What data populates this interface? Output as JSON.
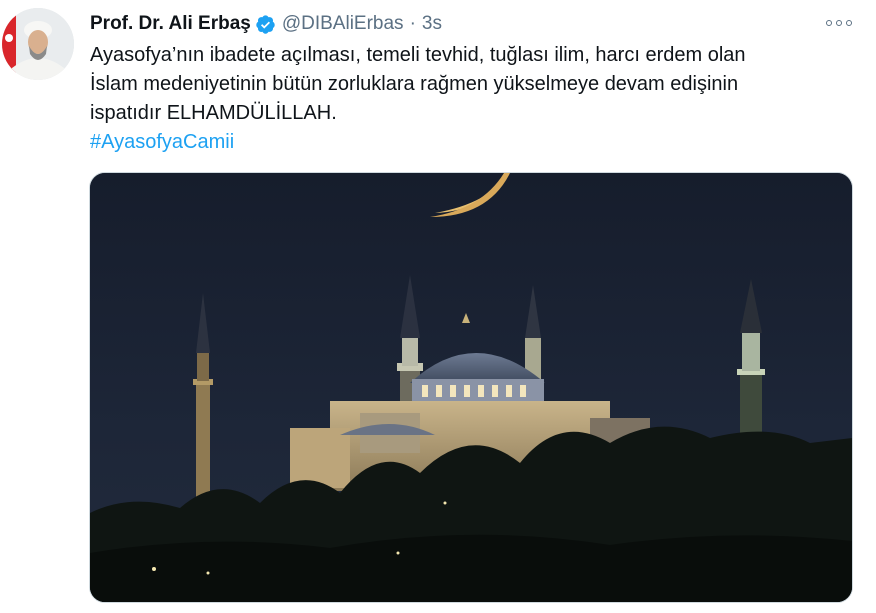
{
  "tweet": {
    "author_name": "Prof. Dr. Ali Erbaş",
    "handle": "@DIBAliErbas",
    "separator": "·",
    "time": "3s",
    "text_lines": [
      "Ayasofya’nın ibadete açılması, temeli tevhid, tuğlası ilim, harcı erdem olan",
      "İslam medeniyetinin bütün zorluklara rağmen yükselmeye devam edişinin",
      "ispatıdır ELHAMDÜLİLLAH."
    ],
    "hashtag": "#AyasofyaCamii"
  },
  "icons": {
    "avatar": "avatar-photo",
    "verified": "verified-badge-icon",
    "more": "more-options-icon",
    "media": "mosque-night-photo"
  },
  "colors": {
    "link": "#1da1f2",
    "verified": "#1da1f2",
    "secondary_text": "#5b7083",
    "primary_text": "#0f1419",
    "sky": "#1b2436",
    "moon": "#e8c070"
  }
}
